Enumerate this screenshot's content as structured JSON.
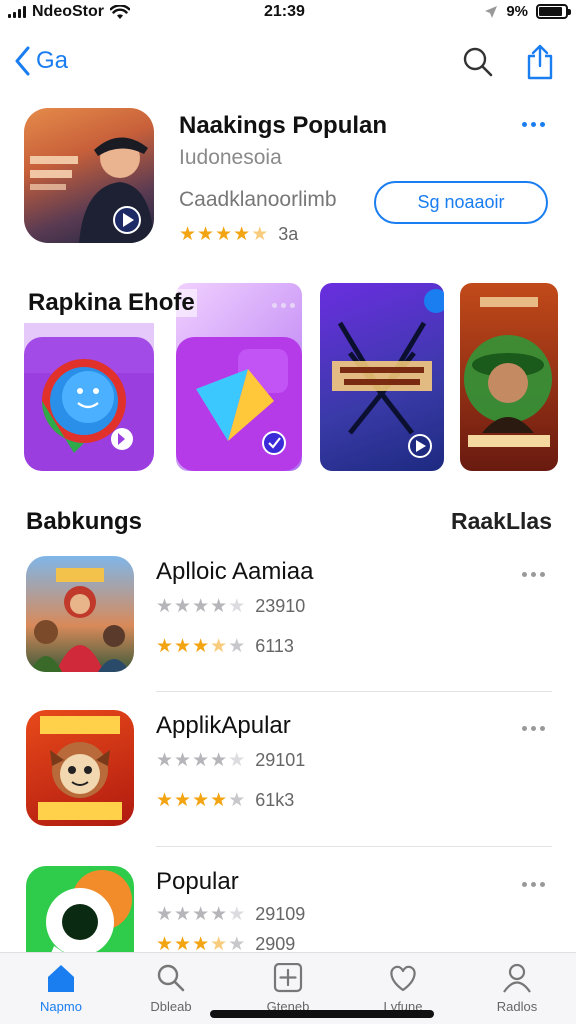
{
  "status_bar": {
    "carrier": "NdeoStor",
    "time": "21:39",
    "battery": "9%",
    "battery_level": 0.9
  },
  "nav": {
    "back_label": "Ga",
    "icons": [
      "search-icon",
      "share-icon"
    ]
  },
  "featured": {
    "title": "Naakings Populan",
    "subtitle": "Iudonesoia",
    "developer": "Caadklanoorlimb",
    "button_label": "Sg noaaoir",
    "rating_count": "3a",
    "rating": 4.5
  },
  "carousel": {
    "title": "Rapkina Ehofe"
  },
  "rankings": {
    "title": "Babkungs",
    "link": "RaakLlas",
    "items": [
      {
        "name": "Aplloic Aamiaa",
        "rating1": 4,
        "count1": "23910",
        "rating2": 3.5,
        "count2": "6113"
      },
      {
        "name": "ApplikApular",
        "rating1": 4,
        "count1": "29101",
        "rating2": 4,
        "count2": "61k3"
      },
      {
        "name": "Popular",
        "rating1": 4,
        "count1": "29109",
        "rating2": 3.5,
        "count2": "2909"
      }
    ]
  },
  "tabs": [
    {
      "label": "Napmo",
      "icon": "home-icon",
      "active": true
    },
    {
      "label": "Dbleab",
      "icon": "search-icon",
      "active": false
    },
    {
      "label": "Gteneb",
      "icon": "plus-square-icon",
      "active": false
    },
    {
      "label": "Lvfune",
      "icon": "heart-icon",
      "active": false
    },
    {
      "label": "Radlos",
      "icon": "profile-icon",
      "active": false
    }
  ],
  "colors": {
    "accent": "#1a7df0",
    "star": "#f3a412"
  }
}
